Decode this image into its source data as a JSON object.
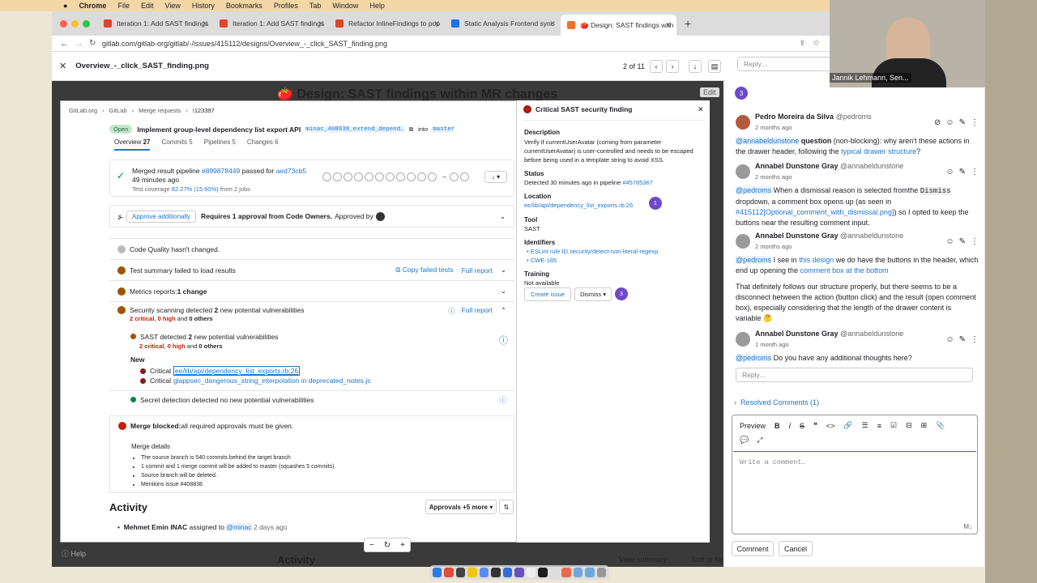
{
  "menubar": {
    "app": "Chrome",
    "items": [
      "File",
      "Edit",
      "View",
      "History",
      "Bookmarks",
      "Profiles",
      "Tab",
      "Window",
      "Help"
    ]
  },
  "tabs": [
    {
      "label": "Iteration 1: Add SAST findings",
      "color": "#e2432a"
    },
    {
      "label": "Iteration 1: Add SAST findings",
      "color": "#e2432a"
    },
    {
      "label": "Refactor InlineFindings to pop",
      "color": "#e2432a"
    },
    {
      "label": "Static Analysis Frontend sync",
      "color": "#1a73e8"
    },
    {
      "label": "🍅 Design: SAST findings with",
      "color": "#fc6d26"
    }
  ],
  "url": "gitlab.com/gitlab-org/gitlab/-/issues/415112/designs/Overview_-_click_SAST_finding.png",
  "viewer": {
    "filename": "Overview_-_click_SAST_finding.png",
    "pager": "2 of 11",
    "bg_title": "🍅 Design: SAST findings within MR changes",
    "edit": "Edit",
    "bottom_title": "Activity",
    "view_summary": "View summary",
    "sort": "Sort or filt"
  },
  "mr": {
    "breadcrumb": [
      "GitLab.org",
      "GitLab",
      "Merge requests",
      "!123397"
    ],
    "status": "Open",
    "title": "Implement group-level dependency list export API",
    "branch": "minac_408838_extend_depend…",
    "into": "into",
    "target": "master",
    "tabs": [
      {
        "label": "Overview",
        "count": "27"
      },
      {
        "label": "Commits",
        "count": "5"
      },
      {
        "label": "Pipelines",
        "count": "5"
      },
      {
        "label": "Changes",
        "count": "6"
      }
    ],
    "pipeline_a": "Merged result pipeline ",
    "pipeline_id": "#899878449",
    "pipeline_b": " passed for ",
    "pipeline_sha": "aed73cb5",
    "pipeline_c": " 49 minutes ago",
    "coverage_a": "Test coverage ",
    "coverage_val": "82.27% (15.60%)",
    "coverage_b": " from 2 jobs",
    "approve_btn": "Approve additionally",
    "approve_text": "Requires 1 approval from Code Owners.",
    "approved_by": "Approved by",
    "quality": "Code Quality hasn't changed.",
    "test_summary": "Test summary failed to load results",
    "copy_tests": "Copy failed tests",
    "full_report": "Full report",
    "metrics_a": "Metrics reports: ",
    "metrics_b": "1 change",
    "security_a": "Security scanning detected ",
    "security_b": "2",
    "security_c": " new potential vulnerabilities",
    "sec_detail_a": "2 critical",
    "sec_detail_b": ", ",
    "sec_detail_c": "0 high",
    "sec_detail_d": " and ",
    "sec_detail_e": "0 others",
    "sast_a": "SAST detected ",
    "sast_b": "2",
    "sast_c": " new potential vulnerabilities",
    "new_label": "New",
    "critical_label": "Critical",
    "finding1": "ee/lib/api/dependency_list_exports.rb:26",
    "finding2": "glappsec_dangerous_string_interpolation in deprecated_notes.js",
    "secret": "Secret detection detected no new potential vulnerabilities",
    "blocked_a": "Merge blocked:",
    "blocked_b": " all required approvals must be given.",
    "details_title": "Merge details",
    "details": [
      "The source branch is 540 commits behind the target branch",
      "1 commit and 1 merge commit will be added to master (squashes 5 commits).",
      "Source branch will be deleted.",
      "Mentions issue #408838"
    ],
    "activity": "Activity",
    "approvals_btn": "Approvals +5 more",
    "assign_name": "Mehmet Emin INAC",
    "assign_text": " assigned to ",
    "assign_user": "@minac",
    "assign_time": " 2 days ago"
  },
  "drawer": {
    "title": "Critical SAST security finding",
    "description_label": "Description",
    "description": "Verify if currentUserAvatar (coming from parameter currentUserAvatar) is user-controlled and needs to be escaped before being used in a template string to avoid XSS.",
    "status_label": "Status",
    "status_a": "Detected 30 minutes ago in pipeline ",
    "status_b": "#45785367",
    "location_label": "Location",
    "location": "ee/lib/api/dependency_list_exports.rb:26",
    "tool_label": "Tool",
    "tool": "SAST",
    "identifiers_label": "Identifiers",
    "identifiers": [
      "ESLint rule ID security/detect-non-literal-regexp",
      "CWE-185"
    ],
    "training_label": "Training",
    "training": "Not available",
    "create_issue": "Create issue",
    "dismiss": "Dismiss",
    "pin1": "1",
    "pin3": "3"
  },
  "comments": {
    "reply_placeholder": "Reply…",
    "pin": "3",
    "c1": {
      "name": "Pedro Moreira da Silva",
      "handle": "@pedroms",
      "time": "2 months ago",
      "mention": "@annabeldunstone",
      "bold": "question",
      "text_a": " (non-blocking): why aren't these actions in the drawer header, following the ",
      "link": "typical drawer structure",
      "text_b": "?"
    },
    "c2": {
      "name": "Annabel Dunstone Gray",
      "handle": "@annabeldunstone",
      "time": "2 months ago",
      "mention": "@pedroms",
      "text_a": " When a dismissal reason is selected fromthe ",
      "code": "Dismiss",
      "text_b": " dropdown, a comment box opens up (as seen in ",
      "link": "#415112[Optional_comment_with_dismissal.png]",
      "text_c": ") so I opted to keep the buttons near the resulting comment input."
    },
    "c3": {
      "name": "Annabel Dunstone Gray",
      "handle": "@annabeldunstone",
      "time": "2 months ago",
      "mention": "@pedroms",
      "text_a": " I see in ",
      "link": "this design",
      "text_b": " we do have the buttons in the header, which end up opening the ",
      "link2": "comment box at the bottom",
      "para2": "That definitely follows our structure properly, but there seems to be a disconnect between the action (button click) and the result (open comment box), especially considering that the length of the drawer content is variable 🤔"
    },
    "c4": {
      "name": "Annabel Dunstone Gray",
      "handle": "@annabeldunstone",
      "time": "1 month ago",
      "mention": "@pedroms",
      "text": " Do you have any additional thoughts here?"
    },
    "resolved": "Resolved Comments (1)",
    "preview": "Preview",
    "placeholder": "Write a comment…",
    "comment_btn": "Comment",
    "cancel_btn": "Cancel"
  },
  "video": {
    "name": "Jannik Lehmann, Sen..."
  },
  "help": "Help"
}
